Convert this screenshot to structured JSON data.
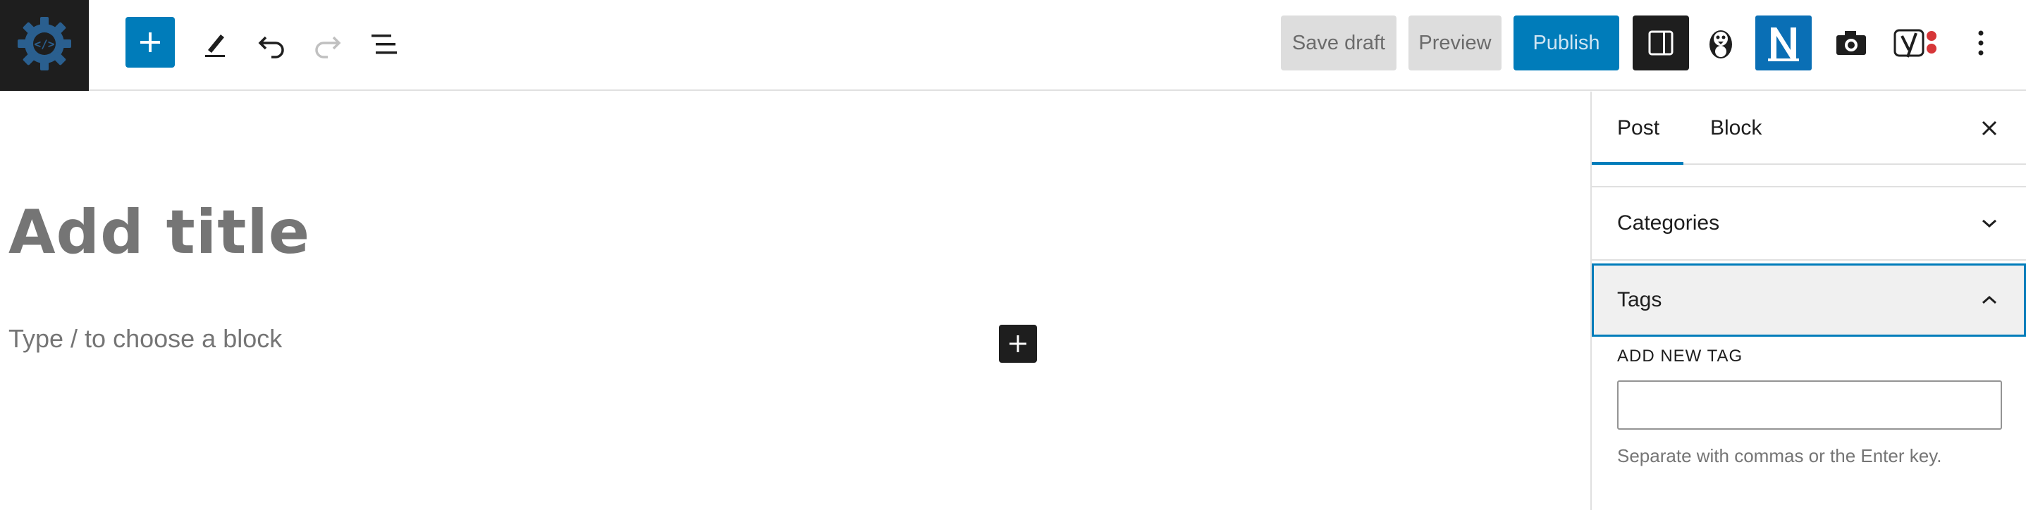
{
  "toolbar": {
    "save_label": "Save draft",
    "preview_label": "Preview",
    "publish_label": "Publish",
    "icons": [
      "wordpress-gear-logo-icon",
      "plus-icon",
      "pencil-icon",
      "undo-icon",
      "redo-icon",
      "list-view-icon",
      "sidebar-toggle-icon",
      "penguin-plugin-icon",
      "n-plugin-icon",
      "camera-icon",
      "yoast-icon",
      "more-options-icon"
    ],
    "colors": {
      "accent": "#007cba",
      "dark": "#1e1e1e",
      "n_plugin": "#0a6fb5"
    }
  },
  "editor": {
    "title_placeholder": "Add title",
    "block_placeholder": "Type / to choose a block"
  },
  "sidebar": {
    "tabs": [
      {
        "label": "Post",
        "active": true
      },
      {
        "label": "Block",
        "active": false
      }
    ],
    "panels": {
      "categories": {
        "label": "Categories",
        "expanded": false
      },
      "tags": {
        "label": "Tags",
        "expanded": true,
        "add_new_label": "ADD NEW TAG",
        "input_value": "",
        "help": "Separate with commas or the Enter key."
      }
    }
  }
}
